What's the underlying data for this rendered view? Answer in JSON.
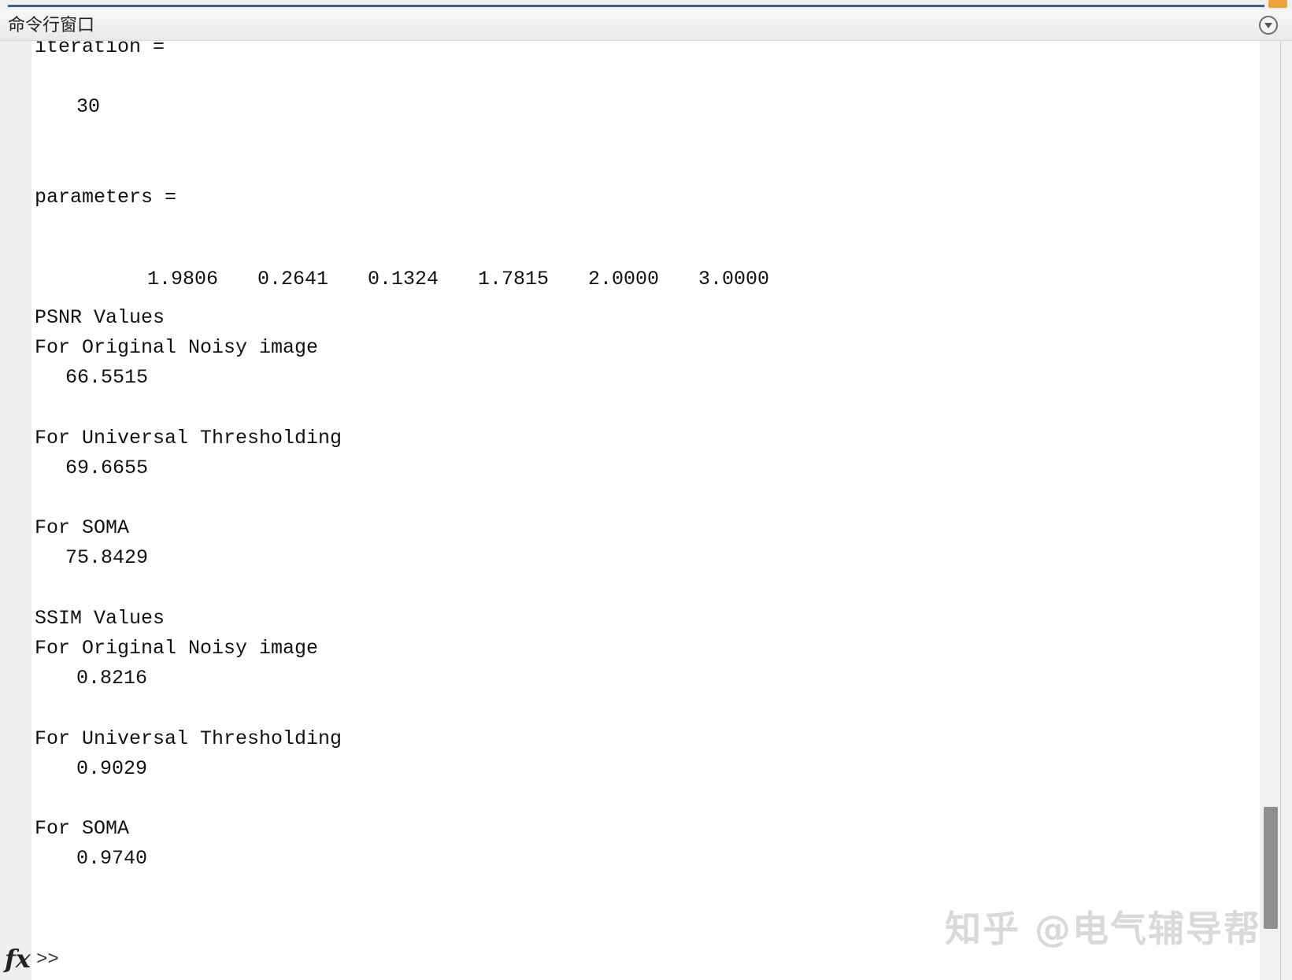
{
  "window": {
    "title": "命令行窗口"
  },
  "output": {
    "iteration_label": "iteration =",
    "iteration_value": "30",
    "parameters_label": "parameters =",
    "parameters_values": [
      "1.9806",
      "0.2641",
      "0.1324",
      "1.7815",
      "2.0000",
      "3.0000"
    ],
    "psnr_header": "PSNR Values",
    "psnr_original_label": "For Original Noisy image",
    "psnr_original_value": "66.5515",
    "psnr_universal_label": "For Universal Thresholding",
    "psnr_universal_value": "69.6655",
    "psnr_soma_label": "For SOMA",
    "psnr_soma_value": "75.8429",
    "ssim_header": "SSIM Values",
    "ssim_original_label": "For Original Noisy image",
    "ssim_original_value": "0.8216",
    "ssim_universal_label": "For Universal Thresholding",
    "ssim_universal_value": "0.9029",
    "ssim_soma_label": "For SOMA",
    "ssim_soma_value": "0.9740"
  },
  "prompt": {
    "fx_label": "fx",
    "arrows": ">>",
    "input_value": ""
  },
  "watermark": "知乎 @电气辅导帮",
  "icons": {
    "title_menu": "chevron-down-circle-icon"
  },
  "colors": {
    "accent_top_line": "#3a5f8f",
    "accent_top_tab": "#f0a23a"
  }
}
